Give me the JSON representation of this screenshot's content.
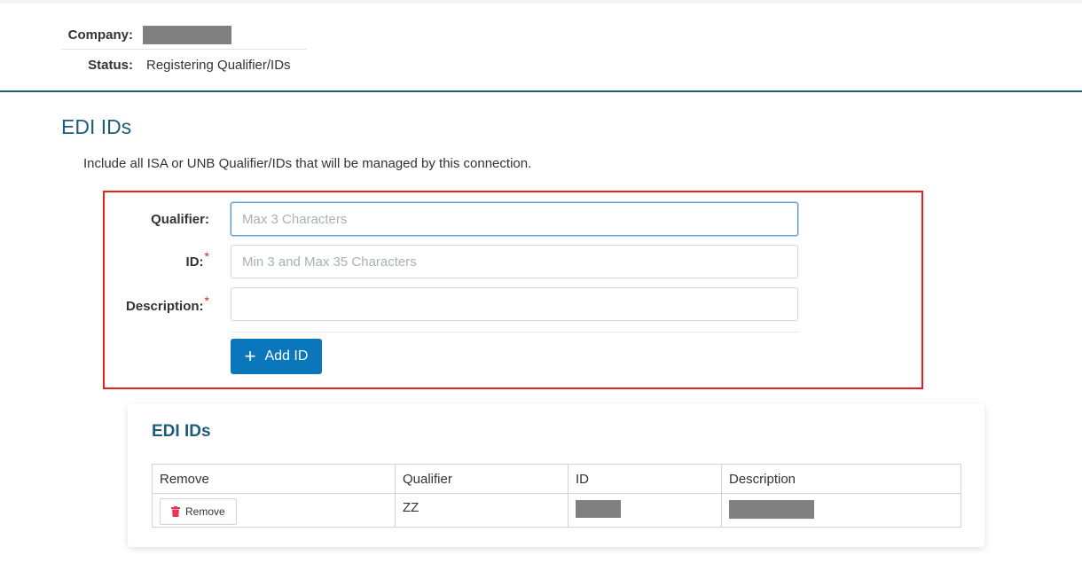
{
  "header": {
    "company_label": "Company:",
    "status_label": "Status:",
    "status_value": "Registering Qualifier/IDs"
  },
  "section": {
    "title": "EDI IDs",
    "intro": "Include all ISA or UNB Qualifier/IDs that will be managed by this connection."
  },
  "form": {
    "qualifier_label": "Qualifier:",
    "qualifier_placeholder": "Max 3 Characters",
    "qualifier_value": "",
    "id_label": "ID:",
    "id_placeholder": "Min 3 and Max 35 Characters",
    "id_value": "",
    "description_label": "Description:",
    "description_value": "",
    "required_marker": "*",
    "add_button_label": "Add ID"
  },
  "table": {
    "title": "EDI IDs",
    "columns": [
      "Remove",
      "Qualifier",
      "ID",
      "Description"
    ],
    "rows": [
      {
        "remove_label": "Remove",
        "qualifier": "ZZ"
      }
    ]
  },
  "colors": {
    "brand_blue": "#1f5c79",
    "button_blue": "#0a77bd",
    "highlight_red": "#e2231a",
    "trash_red": "#e8385a",
    "redaction_gray": "#808080"
  },
  "icons": [
    "plus-icon",
    "trash-icon"
  ]
}
